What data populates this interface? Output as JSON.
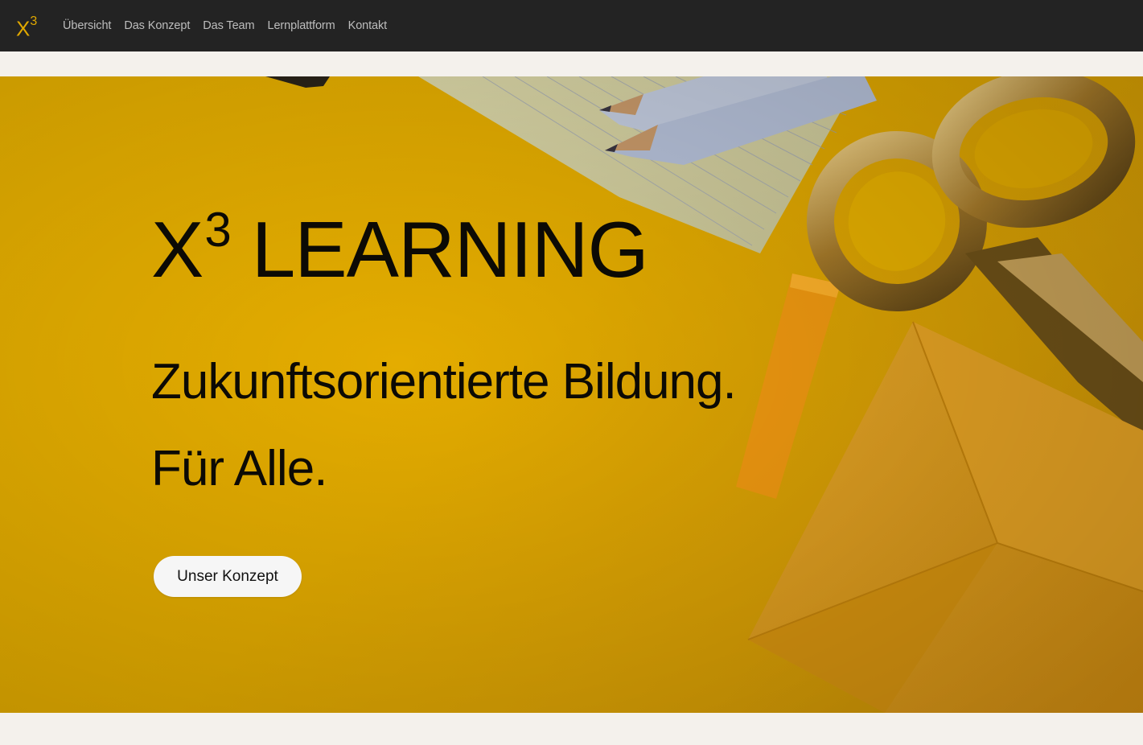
{
  "nav": {
    "brand": "X",
    "brand_sup": "3",
    "links": [
      "Übersicht",
      "Das Konzept",
      "Das Team",
      "Lernplattform",
      "Kontakt"
    ]
  },
  "hero": {
    "title_x": "X",
    "title_sup": "3",
    "title_rest": "LEARNING",
    "tagline_1": "Zukunftsorientierte Bildung.",
    "tagline_2": "Für Alle.",
    "cta_label": "Unser Konzept"
  },
  "colors": {
    "navbar": "#232323",
    "accent": "#e0a800",
    "hero_bg": "#e3ab00",
    "page_bg": "#f4f1ec"
  }
}
